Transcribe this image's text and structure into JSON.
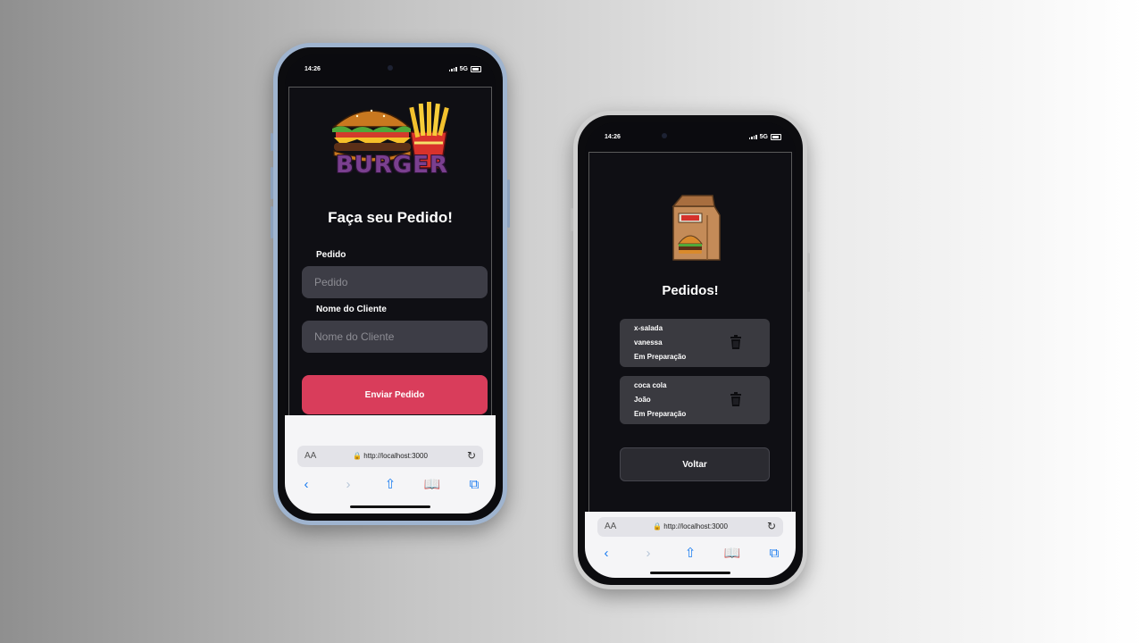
{
  "status_bar": {
    "time": "14:26",
    "network": "5G"
  },
  "order_form": {
    "logo_text": "BURGER",
    "title": "Faça seu Pedido!",
    "order_label": "Pedido",
    "order_placeholder": "Pedido",
    "client_label": "Nome do Cliente",
    "client_placeholder": "Nome do Cliente",
    "submit_label": "Enviar Pedido"
  },
  "orders_page": {
    "title": "Pedidos!",
    "orders": [
      {
        "item": "x-salada",
        "client": "vanessa",
        "status": "Em Preparação"
      },
      {
        "item": "coca cola",
        "client": "João",
        "status": "Em Preparação"
      }
    ],
    "back_label": "Voltar"
  },
  "browser": {
    "text_size_label": "AA",
    "url": "http://localhost:3000"
  },
  "colors": {
    "accent_send": "#d93d5b",
    "input_bg": "#3d3d46",
    "card_bg": "#3a3a40",
    "toolbar_blue": "#1a7cf0"
  }
}
